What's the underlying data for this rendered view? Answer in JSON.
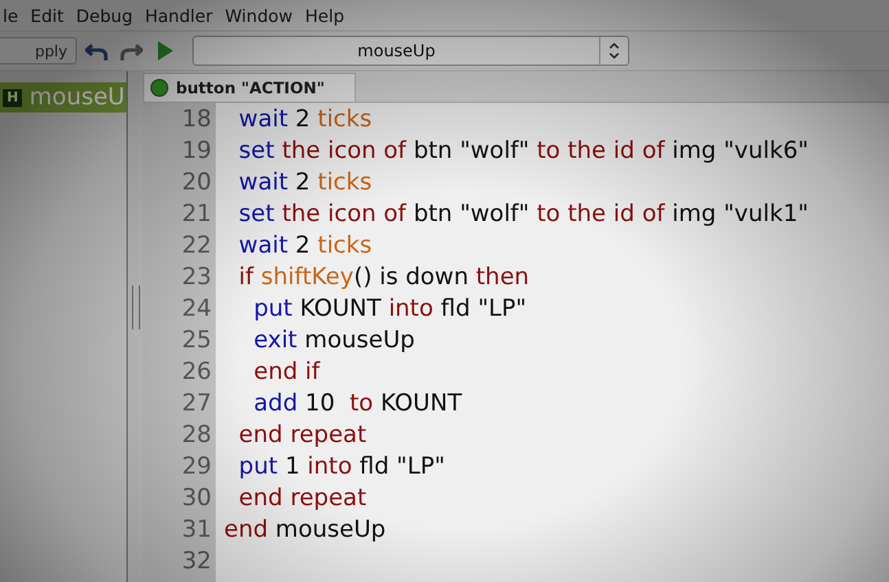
{
  "menu_bar": [
    "le",
    "Edit",
    "Debug",
    "Handler",
    "Window",
    "Help"
  ],
  "toolbar": {
    "apply_button": "pply",
    "handler_select": "mouseUp"
  },
  "handler_list": [
    {
      "badge": "H",
      "name": "mouseU",
      "selected": true
    }
  ],
  "tabs": [
    {
      "label": "button \"ACTION\"",
      "selected": true
    }
  ],
  "code_lines": [
    {
      "number": "18",
      "tokens": [
        {
          "text": "  wait",
          "kind": "command"
        },
        {
          "text": " 2 ",
          "kind": "plain"
        },
        {
          "text": "ticks",
          "kind": "function"
        }
      ]
    },
    {
      "number": "19",
      "tokens": [
        {
          "text": "  set",
          "kind": "command"
        },
        {
          "text": " the icon of",
          "kind": "keyword"
        },
        {
          "text": " btn \"wolf\" ",
          "kind": "plain"
        },
        {
          "text": "to the id of",
          "kind": "keyword"
        },
        {
          "text": " img \"vulk6\"",
          "kind": "plain"
        }
      ]
    },
    {
      "number": "20",
      "tokens": [
        {
          "text": "  wait",
          "kind": "command"
        },
        {
          "text": " 2 ",
          "kind": "plain"
        },
        {
          "text": "ticks",
          "kind": "function"
        }
      ]
    },
    {
      "number": "21",
      "tokens": [
        {
          "text": "  set",
          "kind": "command"
        },
        {
          "text": " the icon of",
          "kind": "keyword"
        },
        {
          "text": " btn \"wolf\" ",
          "kind": "plain"
        },
        {
          "text": "to the id of",
          "kind": "keyword"
        },
        {
          "text": " img \"vulk1\"",
          "kind": "plain"
        }
      ]
    },
    {
      "number": "22",
      "tokens": [
        {
          "text": "  wait",
          "kind": "command"
        },
        {
          "text": " 2 ",
          "kind": "plain"
        },
        {
          "text": "ticks",
          "kind": "function"
        }
      ]
    },
    {
      "number": "23",
      "tokens": [
        {
          "text": "  if",
          "kind": "keyword"
        },
        {
          "text": " shiftKey",
          "kind": "function"
        },
        {
          "text": "() is down ",
          "kind": "plain"
        },
        {
          "text": "then",
          "kind": "keyword"
        }
      ]
    },
    {
      "number": "24",
      "tokens": [
        {
          "text": "    put",
          "kind": "command"
        },
        {
          "text": " KOUNT ",
          "kind": "plain"
        },
        {
          "text": "into",
          "kind": "keyword"
        },
        {
          "text": " fld \"LP\"",
          "kind": "plain"
        }
      ]
    },
    {
      "number": "25",
      "tokens": [
        {
          "text": "    exit",
          "kind": "command"
        },
        {
          "text": " mouseUp",
          "kind": "plain"
        }
      ]
    },
    {
      "number": "26",
      "tokens": [
        {
          "text": "    end if",
          "kind": "keyword"
        }
      ]
    },
    {
      "number": "27",
      "tokens": [
        {
          "text": "    add",
          "kind": "command"
        },
        {
          "text": " 10  ",
          "kind": "plain"
        },
        {
          "text": "to",
          "kind": "keyword"
        },
        {
          "text": " KOUNT",
          "kind": "plain"
        }
      ]
    },
    {
      "number": "28",
      "tokens": [
        {
          "text": "  end repeat",
          "kind": "keyword"
        }
      ]
    },
    {
      "number": "29",
      "tokens": [
        {
          "text": "  put",
          "kind": "command"
        },
        {
          "text": " 1 ",
          "kind": "plain"
        },
        {
          "text": "into",
          "kind": "keyword"
        },
        {
          "text": " fld \"LP\"",
          "kind": "plain"
        }
      ]
    },
    {
      "number": "30",
      "tokens": [
        {
          "text": "  end repeat",
          "kind": "keyword"
        }
      ]
    },
    {
      "number": "31",
      "tokens": [
        {
          "text": "end",
          "kind": "keyword"
        },
        {
          "text": " mouseUp",
          "kind": "plain"
        }
      ]
    },
    {
      "number": "32"
    }
  ]
}
